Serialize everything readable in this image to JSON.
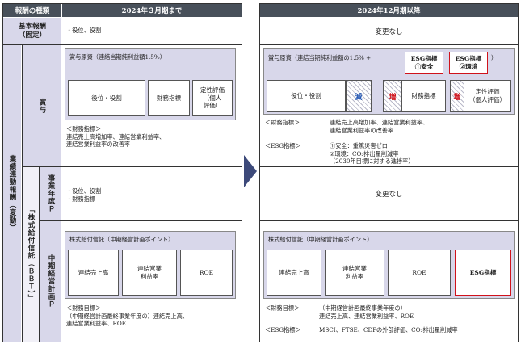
{
  "left": {
    "header_type": "報酬の種類",
    "header_col": "2024年３月期まで",
    "basic_label": "基本報酬\n（固定）",
    "basic_text": "・役位、役割",
    "perf_label": "業績連動報酬（変動）",
    "bonus_label": "賞与",
    "bonus_title": "賞与原資（連結当期純利益額1.5%）",
    "bonus_boxes": [
      "役位・役割",
      "財務指標",
      "定性評価\n（個人\n評価）"
    ],
    "bonus_notes": "＜財務指標＞\n連結売上高増加率、連結営業利益率、\n連結営業利益率の改善率",
    "bbt_label": "「株式給付信託（ＢＢＴ）」",
    "fy_label": "事業年度Ｐ",
    "fy_text": "・役位、役割\n・財務指標",
    "mid_label": "中期経営計画Ｐ",
    "mid_title": "株式給付信託（中期経営計画ポイント）",
    "mid_boxes": [
      "連結売上高",
      "連結営業\n利益率",
      "ROE"
    ],
    "mid_notes": "＜財務目標＞\n（中期経営計画最終事業年度の）連結売上高、\n連結営業利益率、ROE"
  },
  "right": {
    "header_col": "2024年12月期以降",
    "basic_text": "変更なし",
    "bonus_title": "賞与原資（連結当期純利益額の1.5% +",
    "esg1": "ESG指標\n①安全",
    "esg2": "ESG指標\n②環境",
    "bonus_close": "）",
    "role_box": "役位・役割",
    "decrease": "減",
    "increase": "増",
    "fin_box": "財務指標",
    "increase2": "増",
    "qual_box": "定性評価\n（個人評価）",
    "fin_notes_label": "＜財務指標＞",
    "fin_notes": "連結売上高増加率、連結営業利益率、\n連結営業利益率の改善率",
    "esg_notes_label": "＜ESG指標＞",
    "esg_notes": "①安全：重篤災害ゼロ\n②環境：CO₂排出量削減率\n（2030年目標に対する進捗率）",
    "fy_text": "変更なし",
    "mid_title": "株式給付信託（中期経営計画ポイント）",
    "mid_boxes": [
      "連結売上高",
      "連結営業\n利益率",
      "ROE",
      "ESG指標"
    ],
    "mid_fin_label": "＜財務目標＞",
    "mid_fin": "（中期経営計画最終事業年度の）\n連結売上高、連結営業利益率、ROE",
    "mid_esg_label": "＜ESG指標＞",
    "mid_esg": "MSCI、FTSE、CDPの外部評価、CO₂排出量削減率"
  },
  "colors": {
    "header": "#48505a",
    "lavender": "#d8d7ea",
    "arrow": "#3d4a7a",
    "esg_red": "#d0121b",
    "decrease_text": "#2457b3",
    "increase_text": "#d0121b"
  }
}
